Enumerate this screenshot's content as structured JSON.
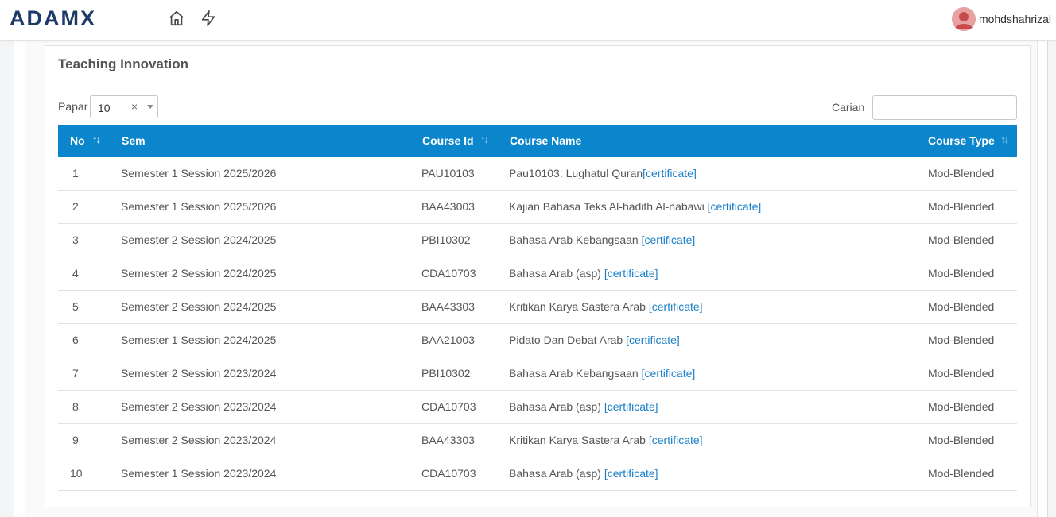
{
  "brand": {
    "logo": "ADAMX"
  },
  "nav": {
    "home_icon": "home-icon",
    "bolt_icon": "lightning-icon"
  },
  "user": {
    "name": "mohdshahrizal",
    "avatar_icon": "user-avatar-icon"
  },
  "card": {
    "title": "Teaching Innovation"
  },
  "controls": {
    "papar_label": "Papar",
    "papar_value": "10",
    "papar_clear": "×",
    "carian_label": "Carian",
    "carian_value": ""
  },
  "table": {
    "headers": {
      "no": "No",
      "sem": "Sem",
      "course_id": "Course Id",
      "course_name": "Course Name",
      "course_type": "Course Type"
    },
    "sort_glyph": "↑↓",
    "cert_label": "[certificate]",
    "rows": [
      {
        "no": "1",
        "sem": "Semester 1 Session 2025/2026",
        "course_id": "PAU10103",
        "course_name": "Pau10103: Lughatul Quran",
        "course_type": "Mod-Blended"
      },
      {
        "no": "2",
        "sem": "Semester 1 Session 2025/2026",
        "course_id": "BAA43003",
        "course_name": "Kajian Bahasa Teks Al-hadith Al-nabawi ",
        "course_type": "Mod-Blended"
      },
      {
        "no": "3",
        "sem": "Semester 2 Session 2024/2025",
        "course_id": "PBI10302",
        "course_name": "Bahasa Arab Kebangsaan ",
        "course_type": "Mod-Blended"
      },
      {
        "no": "4",
        "sem": "Semester 2 Session 2024/2025",
        "course_id": "CDA10703",
        "course_name": "Bahasa Arab (asp) ",
        "course_type": "Mod-Blended"
      },
      {
        "no": "5",
        "sem": "Semester 2 Session 2024/2025",
        "course_id": "BAA43303",
        "course_name": "Kritikan Karya Sastera Arab ",
        "course_type": "Mod-Blended"
      },
      {
        "no": "6",
        "sem": "Semester 1 Session 2024/2025",
        "course_id": "BAA21003",
        "course_name": "Pidato Dan Debat Arab ",
        "course_type": "Mod-Blended"
      },
      {
        "no": "7",
        "sem": "Semester 2 Session 2023/2024",
        "course_id": "PBI10302",
        "course_name": "Bahasa Arab Kebangsaan ",
        "course_type": "Mod-Blended"
      },
      {
        "no": "8",
        "sem": "Semester 2 Session 2023/2024",
        "course_id": "CDA10703",
        "course_name": "Bahasa Arab (asp) ",
        "course_type": "Mod-Blended"
      },
      {
        "no": "9",
        "sem": "Semester 2 Session 2023/2024",
        "course_id": "BAA43303",
        "course_name": "Kritikan Karya Sastera Arab ",
        "course_type": "Mod-Blended"
      },
      {
        "no": "10",
        "sem": "Semester 1 Session 2023/2024",
        "course_id": "CDA10703",
        "course_name": "Bahasa Arab (asp) ",
        "course_type": "Mod-Blended"
      }
    ]
  },
  "colors": {
    "header_bg": "#0b86cc",
    "link": "#1a7fc8",
    "brand": "#1e3a68"
  }
}
